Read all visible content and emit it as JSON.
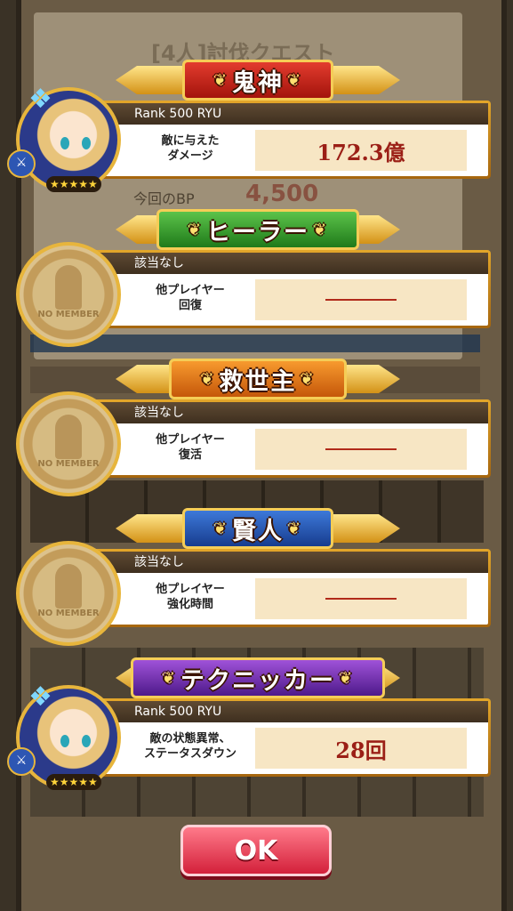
{
  "background": {
    "quest_title": "[4人]討伐クエスト",
    "bp_label": "今回のBP",
    "bp_value": "4,500"
  },
  "awards": [
    {
      "title": "鬼神",
      "theme": "red",
      "player": "Rank 500 RYU",
      "label_line1": "敵に与えた",
      "label_line2": "ダメージ",
      "value": "172.3億",
      "stars": "★★★★★",
      "portrait": "character"
    },
    {
      "title": "ヒーラー",
      "theme": "green",
      "player": "該当なし",
      "label_line1": "他プレイヤー",
      "label_line2": "回復",
      "value": "",
      "portrait": "no-member",
      "no_member_text": "NO MEMBER"
    },
    {
      "title": "救世主",
      "theme": "orange",
      "player": "該当なし",
      "label_line1": "他プレイヤー",
      "label_line2": "復活",
      "value": "",
      "portrait": "no-member",
      "no_member_text": "NO MEMBER"
    },
    {
      "title": "賢人",
      "theme": "blue",
      "player": "該当なし",
      "label_line1": "他プレイヤー",
      "label_line2": "強化時間",
      "value": "",
      "portrait": "no-member",
      "no_member_text": "NO MEMBER"
    },
    {
      "title": "テクニッカー",
      "theme": "purple",
      "player": "Rank 500 RYU",
      "label_line1": "敵の状態異常、",
      "label_line2": "ステータスダウン",
      "value": "28回",
      "stars": "★★★★★",
      "portrait": "character"
    }
  ],
  "ok_button": "OK",
  "colors": {
    "red": "#c01d15",
    "green": "#2f8f24",
    "orange": "#e07a1a",
    "blue": "#2355b3",
    "purple": "#6a2ab0",
    "value_text": "#9b1f16"
  }
}
